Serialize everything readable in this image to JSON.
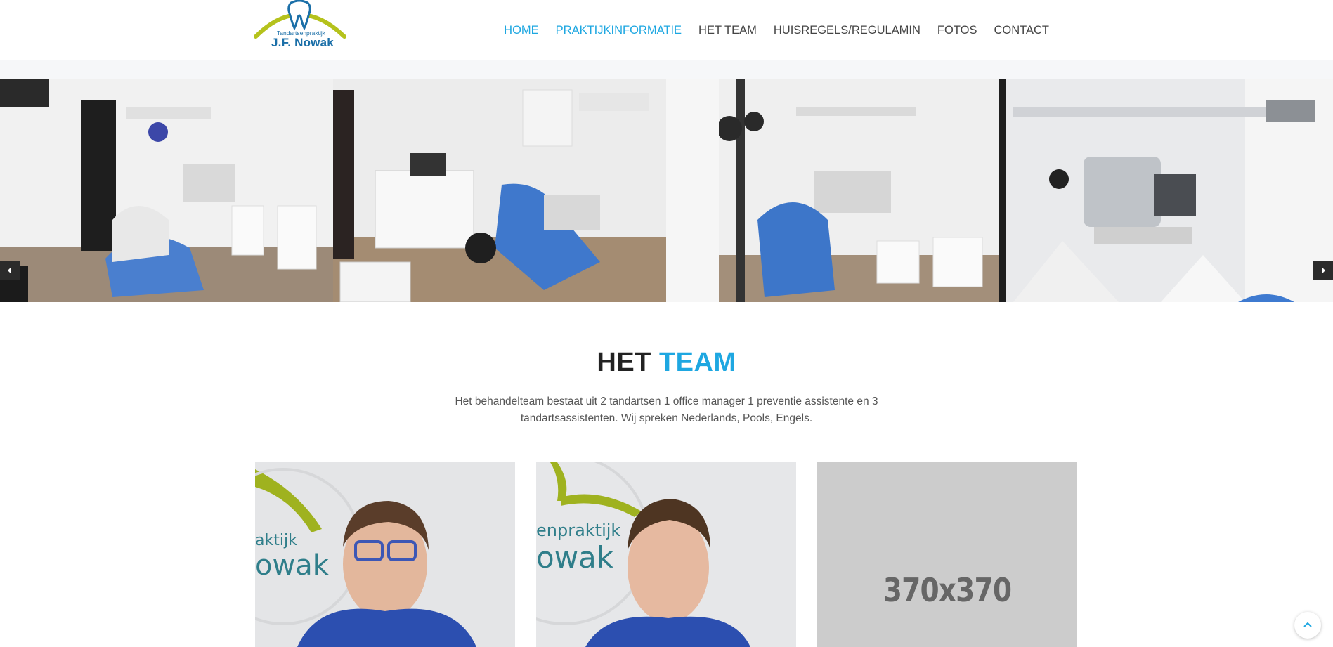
{
  "logo": {
    "small_text": "Tandartsenpraktijk",
    "name": "J.F. Nowak"
  },
  "nav": [
    {
      "label": "HOME",
      "active": true
    },
    {
      "label": "PRAKTIJKINFORMATIE",
      "active": true
    },
    {
      "label": "HET TEAM",
      "active": false
    },
    {
      "label": "HUISREGELS/REGULAMIN",
      "active": false
    },
    {
      "label": "FOTOS",
      "active": false
    },
    {
      "label": "CONTACT",
      "active": false
    }
  ],
  "slider": {
    "prev_icon": "chevron-left-icon",
    "next_icon": "chevron-right-icon"
  },
  "team": {
    "title_part1": "HET",
    "title_part2": "TEAM",
    "description": "Het behandelteam bestaat uit 2 tandartsen 1 office manager 1 preventie assistente en 3 tandartsassistenten. Wij spreken Nederlands, Pools, Engels.",
    "placeholder_label": "370x370"
  },
  "colors": {
    "accent": "#1ea7e1",
    "logo_blue": "#1b6fa8",
    "logo_green": "#b5c21c",
    "uniform_blue": "#2c4fb0"
  },
  "back_to_top_icon": "chevron-up-icon"
}
